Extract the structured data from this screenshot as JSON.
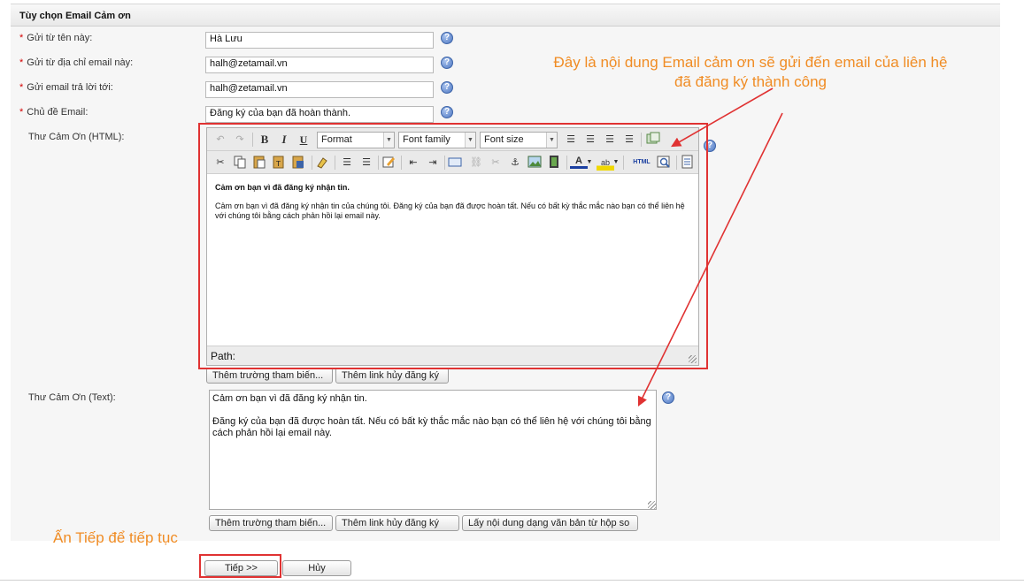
{
  "section_title": "Tùy chọn Email Cảm ơn",
  "required_mark": "*",
  "fields": {
    "from_name": {
      "label": "Gửi từ tên này:",
      "value": "Hà Lưu"
    },
    "from_email": {
      "label": "Gửi từ địa chỉ email này:",
      "value": "halh@zetamail.vn"
    },
    "reply_to": {
      "label": "Gửi email trả lời tới:",
      "value": "halh@zetamail.vn"
    },
    "subject": {
      "label": "Chủ đề Email:",
      "value": "Đăng ký của bạn đã hoàn thành."
    }
  },
  "help_symbol": "?",
  "html_editor": {
    "label": "Thư Cảm Ơn (HTML):",
    "toolbar": {
      "bold": "B",
      "italic": "I",
      "underline": "U",
      "format_select": "Format",
      "font_family_select": "Font family",
      "font_size_select": "Font size",
      "html_button": "HTML"
    },
    "content_heading": "Cảm ơn bạn vì đã đăng ký nhận tin.",
    "content_body": "Cảm ơn bạn vì đã đăng ký nhận tin của chúng tôi. Đăng ký của bạn đã được hoàn tất. Nếu có bất kỳ thắc mắc nào bạn có thể liên hệ với chúng tôi bằng cách phản hồi lại email này.",
    "path_label": "Path:",
    "insert_field_button": "Thêm trường tham biến...",
    "insert_unsubscribe_button": "Thêm link hủy đăng ký"
  },
  "text_editor": {
    "label": "Thư Cảm Ơn (Text):",
    "content": "Cảm ơn bạn vì đã đăng ký nhận tin.\n\nĐăng ký của bạn đã được hoàn tất. Nếu có bất kỳ thắc mắc nào bạn có thể liên hệ với chúng tôi bằng cách phản hồi lại email này.",
    "insert_field_button": "Thêm trường tham biến...",
    "insert_unsubscribe_button": "Thêm link hủy đăng ký",
    "copy_from_html_button": "Lấy nội dung dạng văn bản từ hộp so"
  },
  "actions": {
    "next_button": "Tiếp >>",
    "cancel_button": "Hủy"
  },
  "annotations": {
    "content_note_line1": "Đây là nội dung Email cảm ơn sẽ gửi đến email của liên hệ",
    "content_note_line2": "đã đăng ký thành công",
    "next_note": "Ấn Tiếp để tiếp tục"
  },
  "colors": {
    "annotation_orange": "#f08c24",
    "highlight_red": "#e03232",
    "required_red": "#d40000",
    "help_blue": "#4d77c2"
  }
}
